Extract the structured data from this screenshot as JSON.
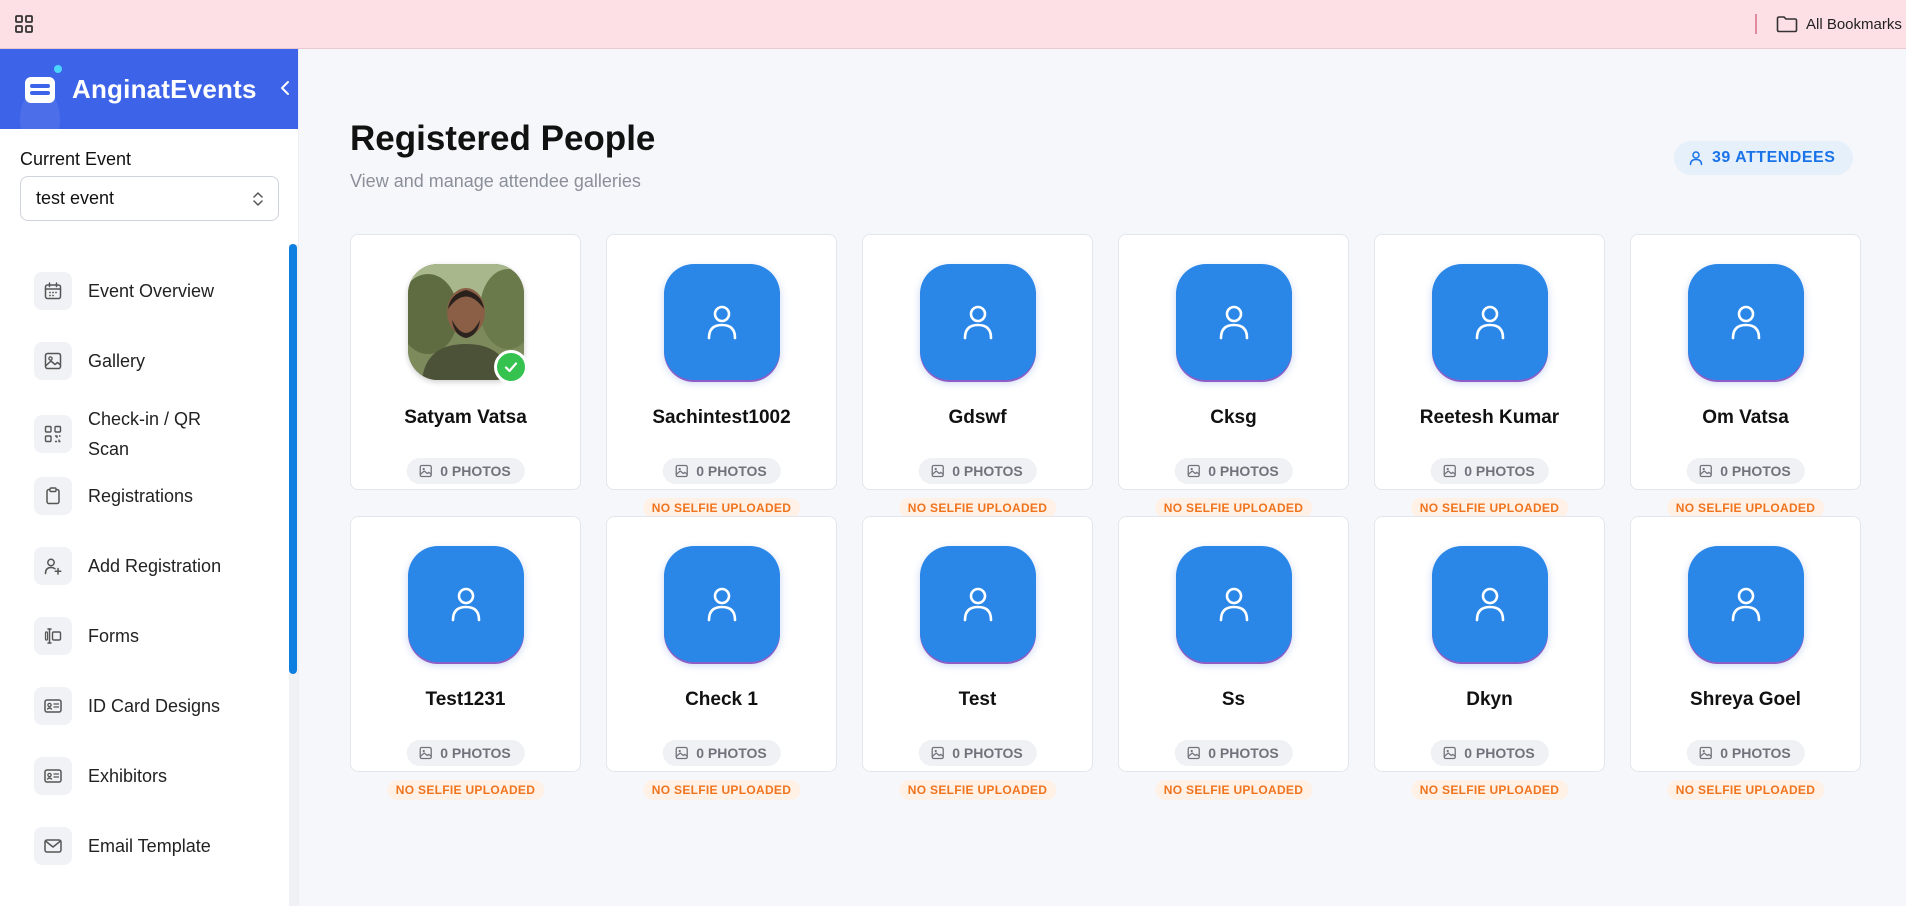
{
  "browser": {
    "bookmarks_label": "All Bookmarks"
  },
  "sidebar": {
    "brand": "AnginatEvents",
    "current_event_label": "Current Event",
    "current_event_value": "test event",
    "items": [
      {
        "label": "Event Overview",
        "icon": "calendar-icon"
      },
      {
        "label": "Gallery",
        "icon": "image-icon"
      },
      {
        "label": "Check-in / QR Scan",
        "icon": "qr-code-icon"
      },
      {
        "label": "Registrations",
        "icon": "clipboard-icon"
      },
      {
        "label": "Add Registration",
        "icon": "user-plus-icon"
      },
      {
        "label": "Forms",
        "icon": "form-icon"
      },
      {
        "label": "ID Card Designs",
        "icon": "id-card-icon"
      },
      {
        "label": "Exhibitors",
        "icon": "id-card-icon"
      },
      {
        "label": "Email Template",
        "icon": "mail-icon"
      }
    ]
  },
  "main": {
    "title": "Registered People",
    "subtitle": "View and manage attendee galleries",
    "attendee_badge": "39 ATTENDEES",
    "photos_label": "0 PHOTOS",
    "no_selfie_label": "NO SELFIE UPLOADED",
    "people": [
      {
        "name": "Satyam Vatsa",
        "photos": "0 PHOTOS",
        "has_selfie": true
      },
      {
        "name": "Sachintest1002",
        "photos": "0 PHOTOS",
        "has_selfie": false
      },
      {
        "name": "Gdswf",
        "photos": "0 PHOTOS",
        "has_selfie": false
      },
      {
        "name": "Cksg",
        "photos": "0 PHOTOS",
        "has_selfie": false
      },
      {
        "name": "Reetesh Kumar",
        "photos": "0 PHOTOS",
        "has_selfie": false
      },
      {
        "name": "Om Vatsa",
        "photos": "0 PHOTOS",
        "has_selfie": false
      },
      {
        "name": "Test1231",
        "photos": "0 PHOTOS",
        "has_selfie": false
      },
      {
        "name": "Check 1",
        "photos": "0 PHOTOS",
        "has_selfie": false
      },
      {
        "name": "Test",
        "photos": "0 PHOTOS",
        "has_selfie": false
      },
      {
        "name": "Ss",
        "photos": "0 PHOTOS",
        "has_selfie": false
      },
      {
        "name": "Dkyn",
        "photos": "0 PHOTOS",
        "has_selfie": false
      },
      {
        "name": "Shreya Goel",
        "photos": "0 PHOTOS",
        "has_selfie": false
      }
    ]
  },
  "colors": {
    "brand_blue": "#3d63e8",
    "avatar_blue": "#2a87e8",
    "accent_blue": "#1a73e8",
    "selfie_warning": "#f0741e",
    "success_green": "#35c24f"
  }
}
